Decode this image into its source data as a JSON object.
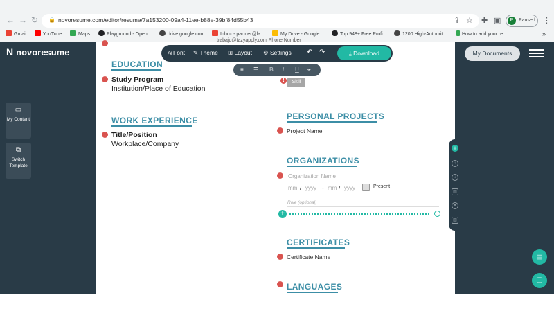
{
  "browser": {
    "url": "novoresume.com/editor/resume/7a153200-09a4-11ee-b88e-39bf84d55b43",
    "profile_initial": "P",
    "profile_status": "Paused",
    "bookmarks": [
      "Gmail",
      "YouTube",
      "Maps",
      "Playground - Open...",
      "drive.google.com",
      "Inbox - partner@la...",
      "My Drive - Google...",
      "Top 948+ Free Profi...",
      "1200 High-Authorit...",
      "How to add your re..."
    ],
    "more_bookmarks": "»"
  },
  "app": {
    "logo": "novoresume",
    "left_panel": {
      "my_content": "My Content",
      "switch_template": "Switch Template"
    },
    "right_panel": {
      "my_documents": "My Documents"
    },
    "toolbar": {
      "font": "Font",
      "theme": "Theme",
      "layout": "Layout",
      "settings": "Settings",
      "download": "Download"
    },
    "skill_tooltip": "Skill",
    "top_glimpse": "trabajo@tazyapply.com            Phone Number"
  },
  "resume": {
    "education": {
      "heading": "EDUCATION",
      "program": "Study Program",
      "institution": "Institution/Place of Education"
    },
    "work": {
      "heading": "WORK EXPERIENCE",
      "title": "Title/Position",
      "company": "Workplace/Company"
    },
    "personal_projects": {
      "heading": "PERSONAL PROJECTS",
      "item": "Project Name"
    },
    "organizations": {
      "heading": "ORGANIZATIONS",
      "name_placeholder": "Organization Name",
      "mm1": "mm",
      "yyyy1": "yyyy",
      "dash": "-",
      "mm2": "mm",
      "yyyy2": "yyyy",
      "present": "Present",
      "role_placeholder": "Role (optional)"
    },
    "certificates": {
      "heading": "CERTIFICATES",
      "item": "Certificate Name"
    },
    "languages": {
      "heading": "LANGUAGES"
    }
  },
  "colors": {
    "accent": "#22b9a4",
    "heading": "#3c8ea6",
    "panel": "#293b47",
    "error": "#d9534f"
  }
}
